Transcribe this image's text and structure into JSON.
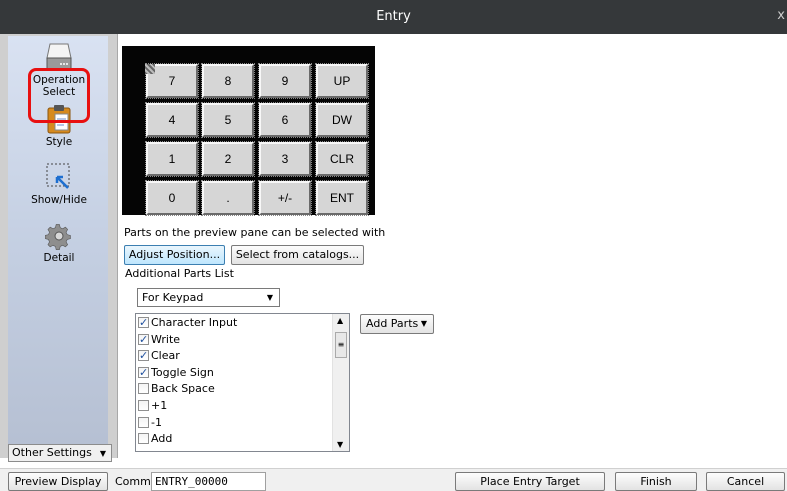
{
  "window": {
    "title": "Entry",
    "close_glyph": "x"
  },
  "sidebar": {
    "items": [
      {
        "label_line1": "Operation",
        "label_line2": "Select",
        "icon": "drive-icon"
      },
      {
        "label": "Style",
        "icon": "clipboard-icon"
      },
      {
        "label": "Show/Hide",
        "icon": "cursor-select-icon"
      },
      {
        "label": "Detail",
        "icon": "gear-icon"
      }
    ],
    "selected": "Style",
    "highlight_color": "#e81010"
  },
  "other_settings": {
    "label": "Other Settings"
  },
  "keypad": {
    "rows": [
      [
        "7",
        "8",
        "9",
        "UP"
      ],
      [
        "4",
        "5",
        "6",
        "DW"
      ],
      [
        "1",
        "2",
        "3",
        "CLR"
      ],
      [
        "0",
        ".",
        "+/-",
        "ENT"
      ]
    ]
  },
  "info_text": "Parts on the preview pane can be selected with",
  "buttons": {
    "adjust_position": "Adjust Position...",
    "select_from_catalogs": "Select from catalogs...",
    "add_parts": "Add Parts"
  },
  "additional_parts_label": "Additional Parts List",
  "combo": {
    "value": "For Keypad"
  },
  "parts_list": [
    {
      "label": "Character Input",
      "checked": true
    },
    {
      "label": "Write",
      "checked": true
    },
    {
      "label": "Clear",
      "checked": true
    },
    {
      "label": "Toggle Sign",
      "checked": true
    },
    {
      "label": "Back Space",
      "checked": false
    },
    {
      "label": "+1",
      "checked": false
    },
    {
      "label": "-1",
      "checked": false
    },
    {
      "label": "Add",
      "checked": false
    }
  ],
  "bottom": {
    "preview_display": "Preview Display",
    "comm_label": "Comm",
    "comm_value": "ENTRY_00000",
    "place_entry_target": "Place Entry Target",
    "finish": "Finish",
    "cancel": "Cancel"
  }
}
